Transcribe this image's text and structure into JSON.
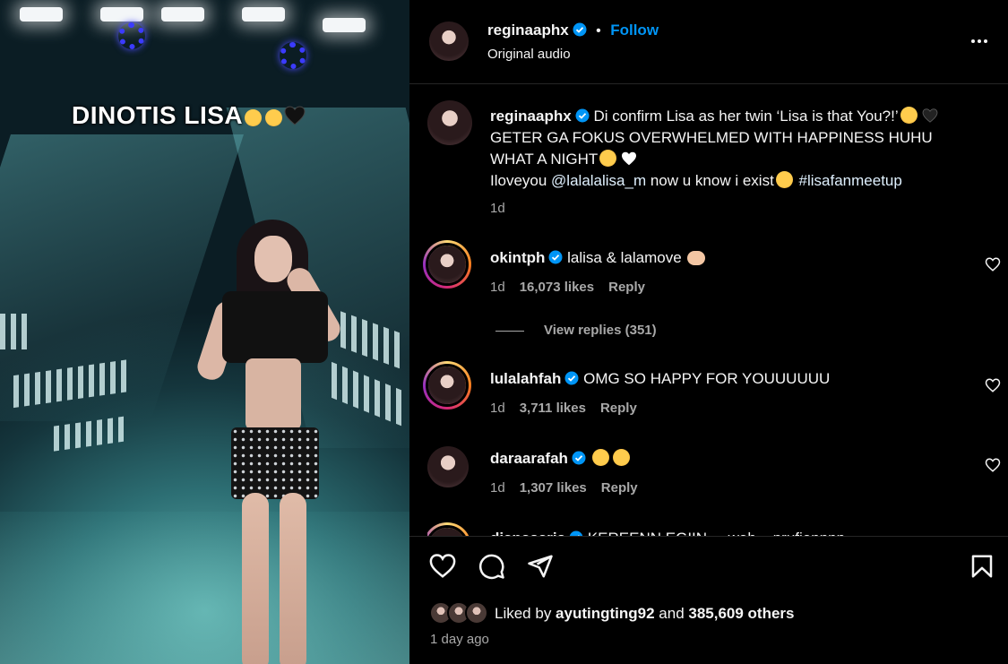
{
  "media": {
    "overlay_caption": "DINOTIS LISA",
    "overlay_emojis": [
      "loudly-crying-face",
      "weary-face",
      "black-heart"
    ]
  },
  "header": {
    "username": "reginaaphx",
    "separator": "•",
    "follow_label": "Follow",
    "audio_label": "Original audio",
    "more_icon": "more-horizontal-icon"
  },
  "caption": {
    "username": "reginaaphx",
    "line1": "Di confirm Lisa as her twin ‘Lisa is that You?!’",
    "line2": "GETER GA FOKUS OVERWHELMED WITH HAPPINESS HUHU",
    "line3": "WHAT A NIGHT",
    "line4_a": "Iloveyou ",
    "line4_mention": "@lalalalisa_m",
    "line4_b": " now u know i exist",
    "line4_tag": " #lisafanmeetup",
    "time": "1d"
  },
  "comments": [
    {
      "username": "okintph",
      "text": "lalisa & lalamove",
      "time": "1d",
      "likes": "16,073 likes",
      "reply": "Reply"
    },
    {
      "username": "lulalahfah",
      "text": "OMG SO HAPPY FOR YOUUUUUU",
      "time": "1d",
      "likes": "3,711 likes",
      "reply": "Reply"
    },
    {
      "username": "daraarafah",
      "text": "",
      "time": "1d",
      "likes": "1,307 likes",
      "reply": "Reply"
    },
    {
      "username": "dianasaris",
      "text": "KEREENN EGIIN ....wah ...prufiennnn"
    }
  ],
  "view_replies": "View replies (351)",
  "footer": {
    "liked_prefix": "Liked by ",
    "liked_user": "ayutingting92",
    "liked_mid": " and ",
    "liked_count": "385,609 others",
    "time_ago": "1 day ago"
  },
  "colors": {
    "accent": "#0095f6",
    "muted": "#a8a8a8",
    "background": "#000000"
  }
}
